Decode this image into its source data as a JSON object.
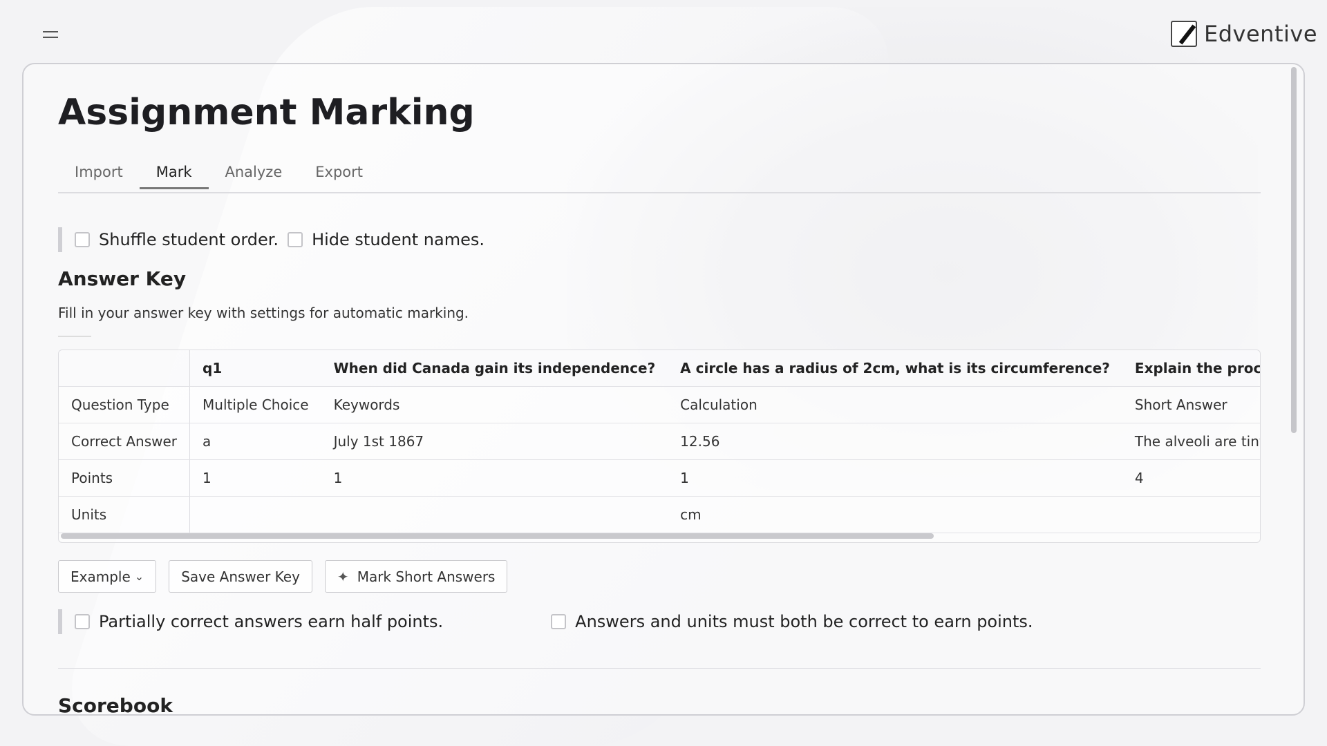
{
  "brand": {
    "name": "Edventive",
    "logo_icon": "pencil-icon"
  },
  "page": {
    "title": "Assignment Marking",
    "tabs": [
      {
        "label": "Import",
        "active": false
      },
      {
        "label": "Mark",
        "active": true
      },
      {
        "label": "Analyze",
        "active": false
      },
      {
        "label": "Export",
        "active": false
      }
    ]
  },
  "options": {
    "shuffle_label": "Shuffle student order.",
    "hide_names_label": "Hide student names."
  },
  "answer_key": {
    "title": "Answer Key",
    "description": "Fill in your answer key with settings for automatic marking.",
    "columns": [
      "q1",
      "When did Canada gain its independence?",
      "A circle has a radius of 2cm, what is its circumference?",
      "Explain the process of gas e"
    ],
    "rows": [
      {
        "label": "Question Type",
        "cells": [
          "Multiple Choice",
          "Keywords",
          "Calculation",
          "Short Answer"
        ]
      },
      {
        "label": "Correct Answer",
        "cells": [
          "a",
          "July 1st 1867",
          "12.56",
          "The alveoli are tiny air sacs l"
        ]
      },
      {
        "label": "Points",
        "cells": [
          "1",
          "1",
          "1",
          "4"
        ]
      },
      {
        "label": "Units",
        "cells": [
          "",
          "",
          "cm",
          ""
        ]
      }
    ]
  },
  "actions": {
    "example_label": "Example",
    "save_label": "Save Answer Key",
    "mark_short_label": "Mark Short Answers"
  },
  "marking_options": {
    "partial_label": "Partially correct answers earn half points.",
    "units_label": "Answers and units must both be correct to earn points."
  },
  "scorebook": {
    "title": "Scorebook"
  }
}
